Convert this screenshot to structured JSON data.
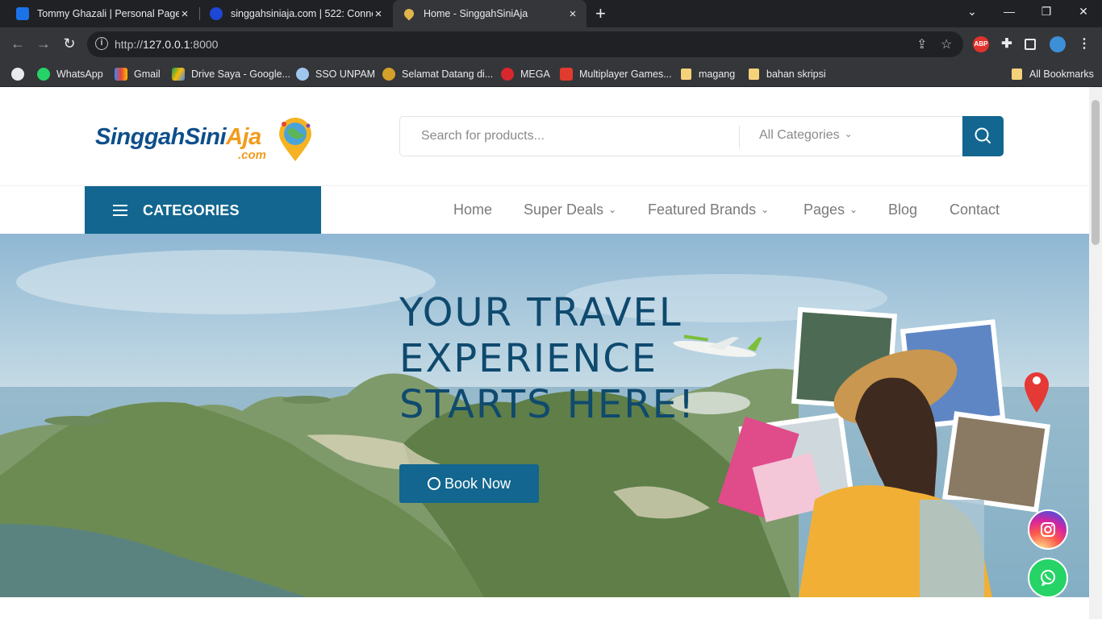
{
  "browser": {
    "tabs": [
      {
        "title": "Tommy Ghazali | Personal Pages",
        "icon": "grid-icon"
      },
      {
        "title": "singgahsiniaja.com | 522: Conne",
        "icon": "globe-icon"
      },
      {
        "title": "Home - SinggahSiniAja",
        "icon": "pin-icon"
      }
    ],
    "new_tab_label": "+",
    "url_host": "127.0.0.1",
    "url_prefix": "http://",
    "url_port": ":8000",
    "bookmarks": [
      {
        "label": "WhatsApp",
        "icon": "whatsapp-icon"
      },
      {
        "label": "Gmail",
        "icon": "gmail-icon"
      },
      {
        "label": "Drive Saya - Google...",
        "icon": "drive-icon"
      },
      {
        "label": "SSO UNPAM",
        "icon": "sso-icon"
      },
      {
        "label": "Selamat Datang di...",
        "icon": "badge-icon"
      },
      {
        "label": "MEGA",
        "icon": "mega-icon"
      },
      {
        "label": "Multiplayer Games...",
        "icon": "games-icon"
      },
      {
        "label": "magang",
        "icon": "folder-icon"
      },
      {
        "label": "bahan skripsi",
        "icon": "folder-icon"
      }
    ],
    "all_bookmarks": "All Bookmarks",
    "extension_abp": "ABP"
  },
  "site": {
    "logo_main": "SinggahSini",
    "logo_accent": "Aja",
    "logo_domain": ".com",
    "search_placeholder": "Search for products...",
    "search_category": "All Categories",
    "categories_label": "CATEGORIES",
    "nav": [
      "Home",
      "Super Deals",
      "Featured Brands",
      "Pages",
      "Blog",
      "Contact"
    ],
    "hero_title": "YOUR TRAVEL\nEXPERIENCE\nSTARTS HERE!",
    "book_now": "Book Now"
  },
  "colors": {
    "brand": "#12668f",
    "hero_text": "#0f4a6e",
    "instagram": "#d6249f",
    "whatsapp": "#25d366"
  }
}
